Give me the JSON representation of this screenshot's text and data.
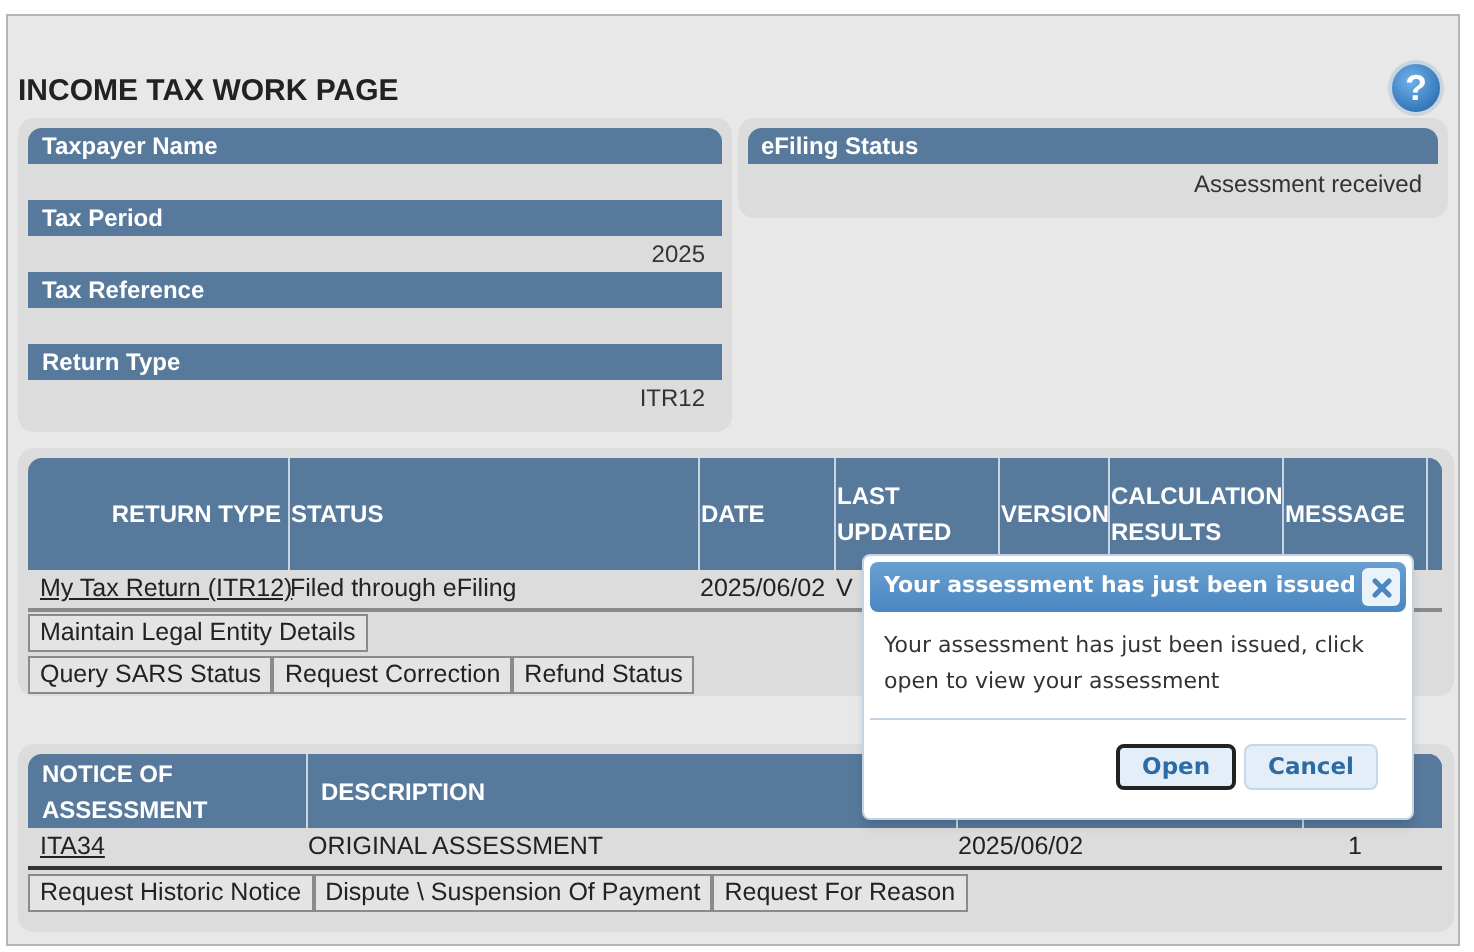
{
  "page_title": "INCOME TAX WORK PAGE",
  "help_button": {
    "label": "?"
  },
  "summary_fields": [
    {
      "label": "Taxpayer Name"
    },
    {
      "label": "Tax Period",
      "value": "2025"
    },
    {
      "label": "Tax Reference"
    },
    {
      "label": "Return Type",
      "value": "ITR12"
    }
  ],
  "efiling_status": {
    "label": "eFiling Status",
    "value": "Assessment received"
  },
  "returns_table": {
    "columns": [
      "RETURN TYPE",
      "STATUS",
      "DATE",
      "LAST UPDATED",
      "VERSION",
      "CALCULATION RESULTS",
      "MESSAGE"
    ],
    "rows": [
      {
        "return_type": "My Tax Return (ITR12)",
        "status": "Filed through eFiling",
        "date": "2025/06/02",
        "last_updated": "V"
      }
    ],
    "action_rows": [
      [
        "Maintain Legal Entity Details"
      ],
      [
        "Query SARS Status",
        "Request Correction",
        "Refund Status"
      ]
    ]
  },
  "assessment_table": {
    "columns": [
      "NOTICE OF ASSESSMENT",
      "DESCRIPTION"
    ],
    "rows": [
      {
        "notice": "ITA34",
        "description": "ORIGINAL ASSESSMENT",
        "column_3": "2025/06/02",
        "column_4": "1"
      }
    ],
    "actions": [
      "Request Historic Notice",
      "Dispute \\ Suspension Of Payment",
      "Request For Reason"
    ]
  },
  "dialog": {
    "title": "Your assessment has just been issued",
    "message": "Your assessment has just been issued, click open to view your assessment",
    "buttons": [
      {
        "label": "Open",
        "selected": true
      },
      {
        "label": "Cancel",
        "selected": false
      }
    ]
  }
}
